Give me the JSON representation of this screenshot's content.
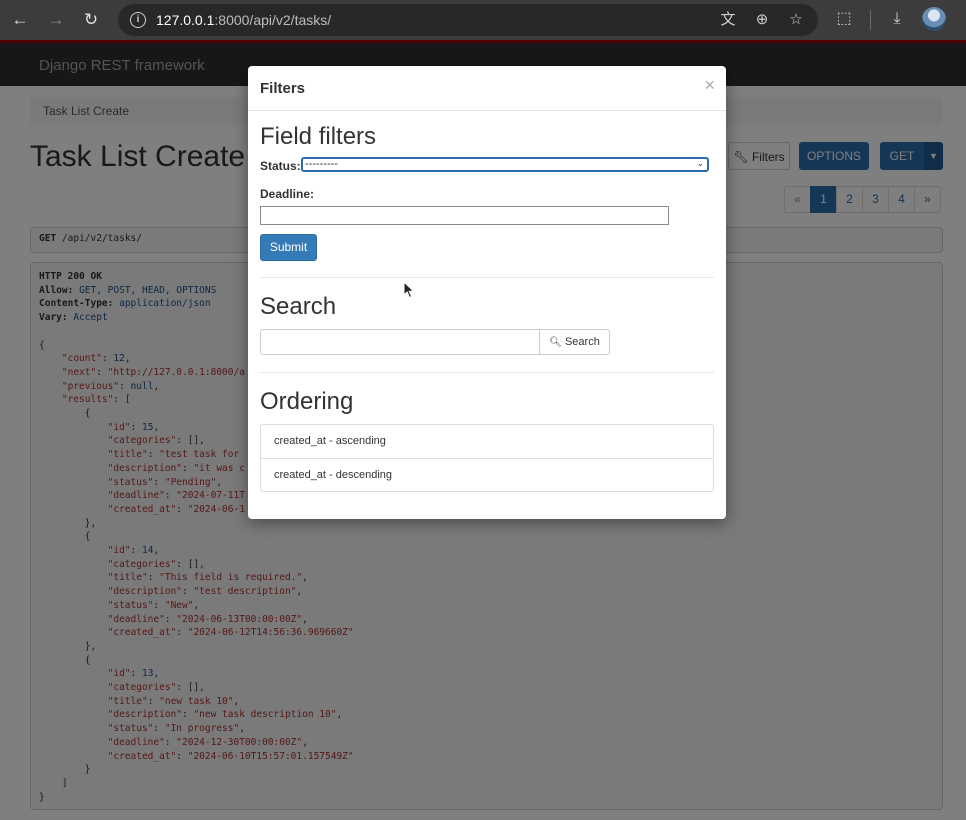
{
  "browser": {
    "url_host": "127.0.0.1",
    "url_path": ":8000/api/v2/tasks/"
  },
  "drf": {
    "brand": "Django REST framework",
    "breadcrumb": "Task List Create",
    "title": "Task List Create",
    "buttons": {
      "filters": "Filters",
      "options": "OPTIONS",
      "get": "GET"
    },
    "pagination": [
      "«",
      "1",
      "2",
      "3",
      "4",
      "»"
    ],
    "pagination_active": "1",
    "request": {
      "method": "GET",
      "path": "/api/v2/tasks/"
    },
    "response_headers": {
      "status": "HTTP 200 OK",
      "allow_label": "Allow:",
      "allow": "GET, POST, HEAD, OPTIONS",
      "content_type_label": "Content-Type:",
      "content_type": "application/json",
      "vary_label": "Vary:",
      "vary": "Accept"
    },
    "json_lines": [
      "{",
      "    \"count\": 12,",
      "    \"next\": \"http://127.0.0.1:8000/a",
      "    \"previous\": null,",
      "    \"results\": [",
      "        {",
      "            \"id\": 15,",
      "            \"categories\": [],",
      "            \"title\": \"test task for",
      "            \"description\": \"it was c",
      "            \"status\": \"Pending\",",
      "            \"deadline\": \"2024-07-11T",
      "            \"created_at\": \"2024-06-1",
      "        },",
      "        {",
      "            \"id\": 14,",
      "            \"categories\": [],",
      "            \"title\": \"This field is required.\",",
      "            \"description\": \"test description\",",
      "            \"status\": \"New\",",
      "            \"deadline\": \"2024-06-13T00:00:00Z\",",
      "            \"created_at\": \"2024-06-12T14:56:36.969660Z\"",
      "        },",
      "        {",
      "            \"id\": 13,",
      "            \"categories\": [],",
      "            \"title\": \"new task 10\",",
      "            \"description\": \"new task description 10\",",
      "            \"status\": \"In progress\",",
      "            \"deadline\": \"2024-12-30T00:00:00Z\",",
      "            \"created_at\": \"2024-06-10T15:57:01.157549Z\"",
      "        }",
      "    ]",
      "}"
    ]
  },
  "modal": {
    "title": "Filters",
    "close": "×",
    "field_filters_heading": "Field filters",
    "status_label": "Status:",
    "status_value": "---------",
    "deadline_label": "Deadline:",
    "deadline_value": "",
    "submit_label": "Submit",
    "search_heading": "Search",
    "search_value": "",
    "search_button": "Search",
    "ordering_heading": "Ordering",
    "ordering_options": [
      "created_at - ascending",
      "created_at - descending"
    ]
  },
  "colors": {
    "primary": "#2c6cad",
    "navbar": "#2f2f2f",
    "accent_line": "#a30000",
    "json_key": "#a33",
    "json_number": "#1f4d84"
  },
  "icons": [
    "back-arrow-icon",
    "forward-arrow-icon",
    "reload-icon",
    "info-icon",
    "translate-icon",
    "zoom-icon",
    "star-icon",
    "extensions-icon",
    "download-icon",
    "wrench-icon",
    "caret-down-icon",
    "search-icon",
    "close-icon",
    "cursor-icon"
  ]
}
